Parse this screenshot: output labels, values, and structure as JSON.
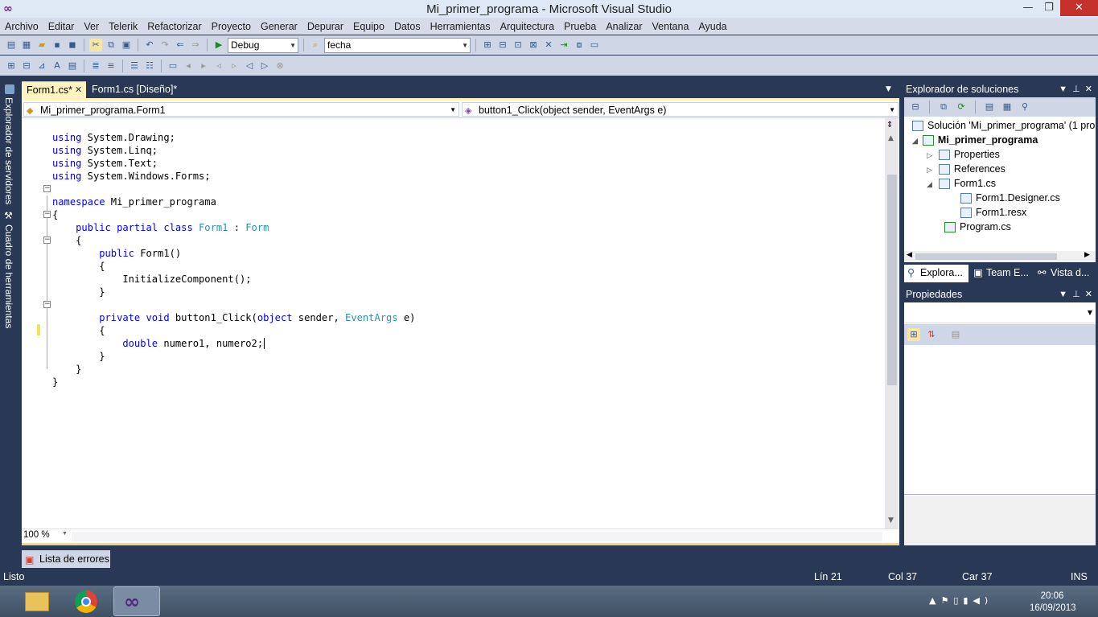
{
  "window": {
    "title": "Mi_primer_programa - Microsoft Visual Studio",
    "minimize": "—",
    "restore": "❐",
    "close": "✕"
  },
  "menu": [
    "Archivo",
    "Editar",
    "Ver",
    "Telerik",
    "Refactorizar",
    "Proyecto",
    "Generar",
    "Depurar",
    "Equipo",
    "Datos",
    "Herramientas",
    "Arquitectura",
    "Prueba",
    "Analizar",
    "Ventana",
    "Ayuda"
  ],
  "toolbar": {
    "config": "Debug",
    "find": "fecha"
  },
  "sidebar": {
    "server_explorer": "Explorador de servidores",
    "toolbox": "Cuadro de herramientas"
  },
  "tabs": [
    {
      "label": "Form1.cs*",
      "close": "✕"
    },
    {
      "label": "Form1.cs [Diseño]*"
    }
  ],
  "nav": {
    "class": "Mi_primer_programa.Form1",
    "member": "button1_Click(object sender, EventArgs e)"
  },
  "code": {
    "l1": [
      "using",
      " System.Drawing;"
    ],
    "l2": [
      "using",
      " System.Linq;"
    ],
    "l3": [
      "using",
      " System.Text;"
    ],
    "l4": [
      "using",
      " System.Windows.Forms;"
    ],
    "l6": [
      "namespace",
      " Mi_primer_programa"
    ],
    "l7": "{",
    "l8": [
      "    public partial class ",
      "Form1",
      " : ",
      "Form"
    ],
    "l9": "    {",
    "l10": [
      "        public",
      " Form1()"
    ],
    "l11": "        {",
    "l12": "            InitializeComponent();",
    "l13": "        }",
    "l15": [
      "        private void",
      " button1_Click(",
      "object",
      " sender, ",
      "EventArgs",
      " e)"
    ],
    "l16": "        {",
    "l17": [
      "            double",
      " numero1, numero2;"
    ],
    "l18": "        }",
    "l19": "    }",
    "l20": "}"
  },
  "zoom": "100 %",
  "error_list": "Lista de errores",
  "status": {
    "ready": "Listo",
    "line": "Lín 21",
    "col": "Col 37",
    "char": "Car 37",
    "ins": "INS"
  },
  "solution_explorer": {
    "title": "Explorador de soluciones",
    "solution": "Solución 'Mi_primer_programa'  (1 pro",
    "project": "Mi_primer_programa",
    "items": [
      "Properties",
      "References",
      "Form1.cs",
      "Form1.Designer.cs",
      "Form1.resx",
      "Program.cs"
    ],
    "tabs": [
      "Explora...",
      "Team E...",
      "Vista d..."
    ]
  },
  "properties": {
    "title": "Propiedades"
  },
  "clock": {
    "time": "20:06",
    "date": "16/09/2013"
  }
}
